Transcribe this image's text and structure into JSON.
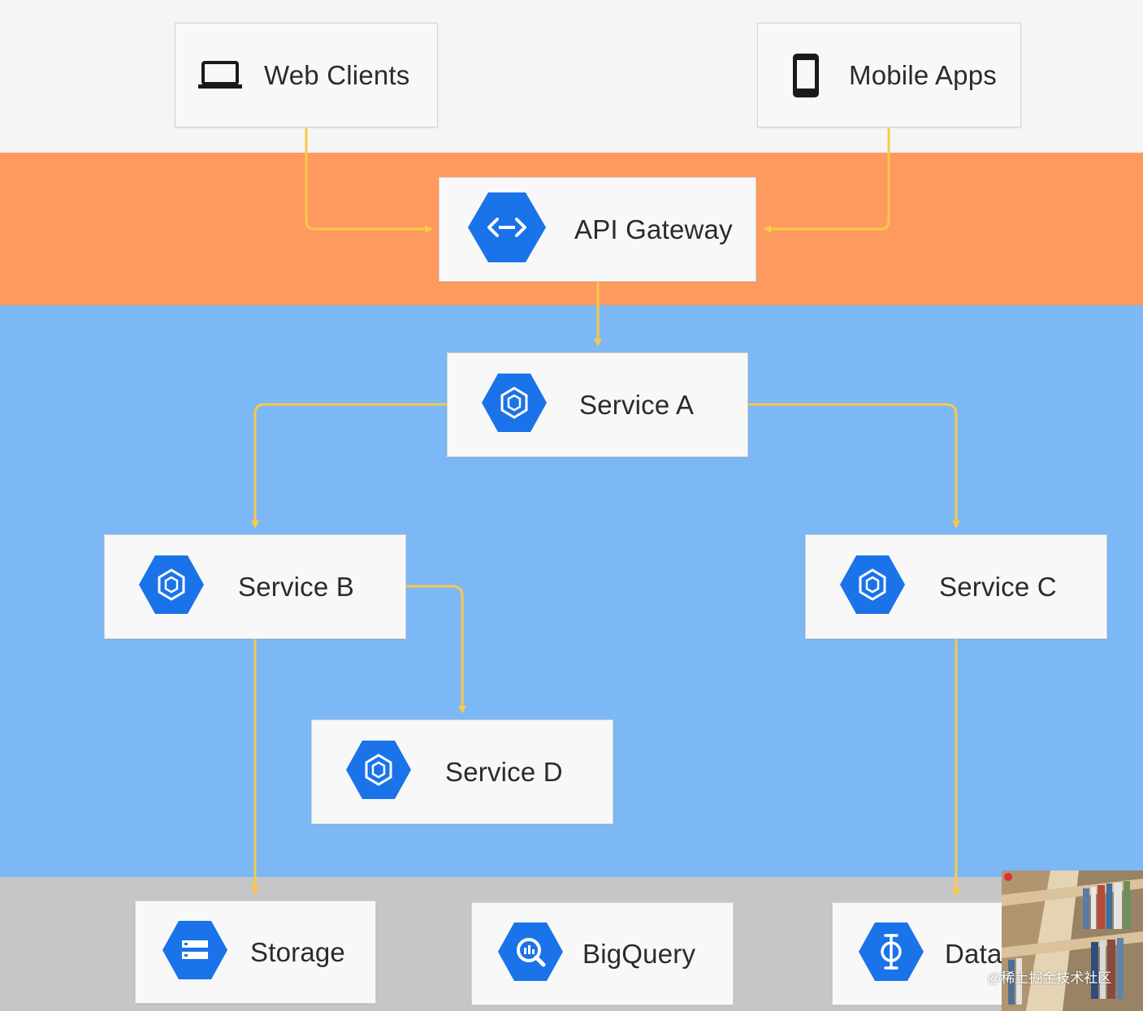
{
  "layers": {
    "clients_color": "#f5f5f5",
    "gateway_color": "#ff9a5f",
    "services_color": "#7bb8f5",
    "data_color": "#c6c6c6"
  },
  "connector_color": "#f7c948",
  "hex_color": "#1a73e8",
  "nodes": {
    "web_clients": {
      "label": "Web Clients",
      "icon": "laptop-icon"
    },
    "mobile_apps": {
      "label": "Mobile Apps",
      "icon": "smartphone-icon"
    },
    "api_gateway": {
      "label": "API Gateway",
      "icon": "api-endpoints-icon"
    },
    "service_a": {
      "label": "Service A",
      "icon": "kubernetes-engine-icon"
    },
    "service_b": {
      "label": "Service B",
      "icon": "kubernetes-engine-icon"
    },
    "service_c": {
      "label": "Service C",
      "icon": "kubernetes-engine-icon"
    },
    "service_d": {
      "label": "Service D",
      "icon": "kubernetes-engine-icon"
    },
    "storage": {
      "label": "Storage",
      "icon": "cloud-storage-icon"
    },
    "bigquery": {
      "label": "BigQuery",
      "icon": "bigquery-icon"
    },
    "data": {
      "label": "Data",
      "icon": "dataflow-icon"
    }
  },
  "edges": [
    [
      "web_clients",
      "api_gateway"
    ],
    [
      "mobile_apps",
      "api_gateway"
    ],
    [
      "api_gateway",
      "service_a"
    ],
    [
      "service_a",
      "service_b"
    ],
    [
      "service_a",
      "service_c"
    ],
    [
      "service_b",
      "service_d"
    ],
    [
      "service_b",
      "storage"
    ],
    [
      "service_c",
      "data"
    ]
  ],
  "watermark": "@稀土掘金技术社区"
}
